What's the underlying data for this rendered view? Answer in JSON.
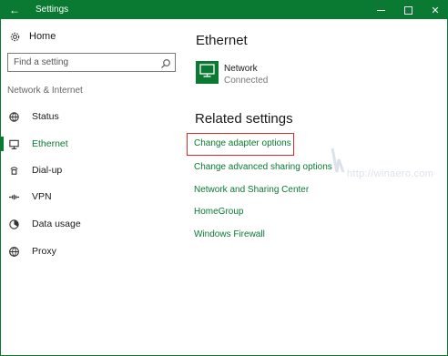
{
  "window": {
    "title": "Settings",
    "back_icon": "back-arrow-icon",
    "min_icon": "minimize-icon",
    "max_icon": "maximize-icon",
    "close_icon": "close-icon",
    "accent": "#0a7a32"
  },
  "sidebar": {
    "home_label": "Home",
    "search_placeholder": "Find a setting",
    "section_label": "Network & Internet",
    "items": [
      {
        "label": "Status",
        "icon": "globe-status-icon"
      },
      {
        "label": "Ethernet",
        "icon": "ethernet-icon",
        "active": true
      },
      {
        "label": "Dial-up",
        "icon": "dialup-icon"
      },
      {
        "label": "VPN",
        "icon": "vpn-icon"
      },
      {
        "label": "Data usage",
        "icon": "data-usage-icon"
      },
      {
        "label": "Proxy",
        "icon": "globe-icon"
      }
    ]
  },
  "main": {
    "title": "Ethernet",
    "network": {
      "name": "Network",
      "status": "Connected",
      "icon": "monitor-network-icon"
    },
    "related_title": "Related settings",
    "links": [
      "Change adapter options",
      "Change advanced sharing options",
      "Network and Sharing Center",
      "HomeGroup",
      "Windows Firewall"
    ],
    "highlight_color": "#e02828"
  },
  "watermark": {
    "text": "http://winaero.com"
  }
}
